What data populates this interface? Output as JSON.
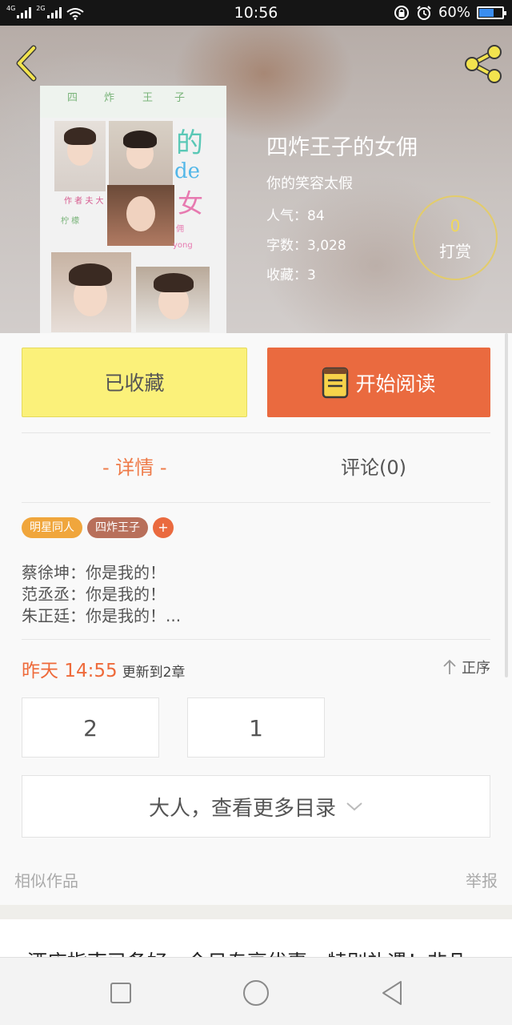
{
  "status_bar": {
    "net_4g": "4G",
    "net_2g": "2G",
    "time": "10:56",
    "battery": "60%",
    "battery_level": 0.6
  },
  "book": {
    "title": "四炸王子的女佣",
    "author": "你的笑容太假",
    "popularity": "人气：84",
    "word_count": "字数：3,028",
    "favorites": "收藏：3"
  },
  "reward": {
    "count": "0",
    "label": "打赏"
  },
  "actions": {
    "favorited_label": "已收藏",
    "read_label": "开始阅读"
  },
  "tabs": {
    "detail": "- 详情 -",
    "comments": "评论(0)"
  },
  "tags": [
    "明星同人",
    "四炸王子",
    "+"
  ],
  "description": [
    "蔡徐坤：你是我的！",
    "范丞丞：你是我的！",
    "朱正廷：你是我的！..."
  ],
  "update": {
    "when": "昨天 14:55",
    "text": "更新到2章",
    "sort_label": "正序"
  },
  "chapters": [
    "2",
    "1"
  ],
  "more_catalog": "大人，查看更多目录",
  "footer_links": {
    "similar": "相似作品",
    "report": "举报"
  },
  "ad_text": "酒店指南已备好，今日专享优惠，特别礼遇！非凡",
  "colors": {
    "accent_orange": "#ea6a3f",
    "fav_yellow": "#fbf17a",
    "tag_orange": "#f0a63c",
    "tag_brown": "#b86f5a"
  }
}
